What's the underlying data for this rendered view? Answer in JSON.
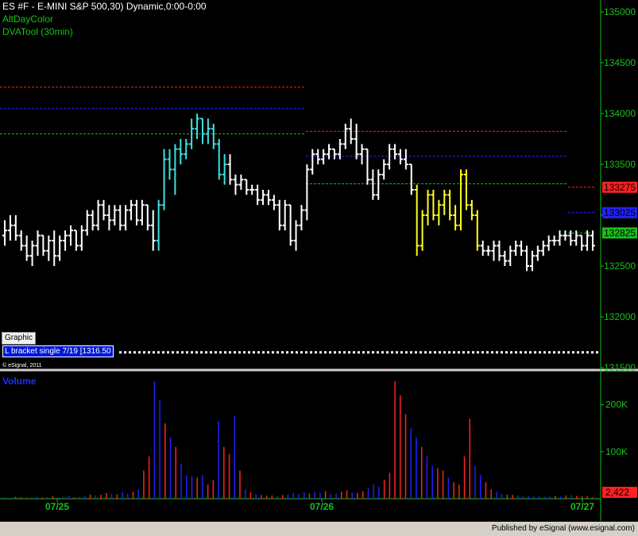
{
  "header": {
    "title": "ES #F - E-MINI S&P 500,30) Dynamic,0:00-0:00",
    "study1": "AltDayColor",
    "study2": "DVATool (30min)"
  },
  "graphic_button": "Graphic",
  "bracket_label": "L bracket single 7/19 [1316.50",
  "copyright": "© eSignal, 2011",
  "volume_title": "Volume",
  "published": "Published by eSignal (www.esignal.com)",
  "colors": {
    "background": "#000000",
    "axis_text": "#18c018",
    "up_day1": "#ffffff",
    "hi_day1": "#40e0e0",
    "hi_day2": "#ffff20",
    "vol_up": "#2020ff",
    "vol_down": "#ff2020",
    "level_red": "#ff2020",
    "level_blue": "#2020ff",
    "level_green": "#18c018"
  },
  "chart_data": [
    {
      "type": "ohlc",
      "ylim": [
        1315,
        1350
      ],
      "ytick_labels": [
        "135000",
        "134500",
        "134000",
        "133500",
        "133000",
        "132500",
        "132000",
        "131500"
      ],
      "ytick_values": [
        1350,
        1345,
        1340,
        1335,
        1330,
        1325,
        1320,
        1315
      ],
      "x_labels": [
        "07/25",
        "07/26",
        "07/27"
      ],
      "price_boxes": [
        {
          "label": "133275",
          "value": 1332.75,
          "color": "#ff2020",
          "text_color": "#000000"
        },
        {
          "label": "133025",
          "value": 1330.25,
          "color": "#2020ff",
          "text_color": "#000000"
        },
        {
          "label": "132825",
          "value": 1328.25,
          "color": "#18c018",
          "text_color": "#000000"
        }
      ],
      "levels": [
        {
          "value": 1342.6,
          "color": "#ff2020",
          "x_from": 0,
          "x_to": 385
        },
        {
          "value": 1340.5,
          "color": "#2020ff",
          "x_from": 0,
          "x_to": 385
        },
        {
          "value": 1338.0,
          "color": "#18c018",
          "x_from": 0,
          "x_to": 385
        },
        {
          "value": 1338.25,
          "color": "#ff2020",
          "x_from": 385,
          "x_to": 715
        },
        {
          "value": 1335.8,
          "color": "#2020ff",
          "x_from": 385,
          "x_to": 715
        },
        {
          "value": 1333.1,
          "color": "#18c018",
          "x_from": 385,
          "x_to": 715
        },
        {
          "value": 1332.75,
          "color": "#ff2020",
          "x_from": 715,
          "x_to": 750
        },
        {
          "value": 1330.25,
          "color": "#2020ff",
          "x_from": 715,
          "x_to": 750
        },
        {
          "value": 1328.25,
          "color": "#18c018",
          "x_from": 715,
          "x_to": 750
        },
        {
          "value": 1316.5,
          "color": "#ffffff",
          "x_from": 150,
          "x_to": 755,
          "dotted": true
        }
      ],
      "bars": [
        {
          "o": 1328.0,
          "h": 1329.5,
          "l": 1327.0,
          "c": 1328.5,
          "col": "w"
        },
        {
          "o": 1328.5,
          "h": 1330.0,
          "l": 1327.5,
          "c": 1329.0,
          "col": "w"
        },
        {
          "o": 1329.0,
          "h": 1330.0,
          "l": 1327.5,
          "c": 1328.0,
          "col": "w"
        },
        {
          "o": 1328.0,
          "h": 1328.5,
          "l": 1326.5,
          "c": 1327.0,
          "col": "w"
        },
        {
          "o": 1327.0,
          "h": 1328.0,
          "l": 1325.5,
          "c": 1326.0,
          "col": "w"
        },
        {
          "o": 1326.0,
          "h": 1327.5,
          "l": 1325.0,
          "c": 1327.0,
          "col": "w"
        },
        {
          "o": 1327.0,
          "h": 1328.5,
          "l": 1326.0,
          "c": 1328.0,
          "col": "w"
        },
        {
          "o": 1328.0,
          "h": 1328.0,
          "l": 1326.0,
          "c": 1326.5,
          "col": "w"
        },
        {
          "o": 1326.5,
          "h": 1328.0,
          "l": 1325.5,
          "c": 1327.5,
          "col": "w"
        },
        {
          "o": 1327.5,
          "h": 1328.5,
          "l": 1325.0,
          "c": 1326.0,
          "col": "w"
        },
        {
          "o": 1326.0,
          "h": 1328.0,
          "l": 1325.5,
          "c": 1327.5,
          "col": "w"
        },
        {
          "o": 1327.5,
          "h": 1328.5,
          "l": 1326.5,
          "c": 1328.0,
          "col": "w"
        },
        {
          "o": 1328.0,
          "h": 1329.0,
          "l": 1327.0,
          "c": 1328.5,
          "col": "w"
        },
        {
          "o": 1328.5,
          "h": 1328.5,
          "l": 1326.5,
          "c": 1327.0,
          "col": "w"
        },
        {
          "o": 1327.0,
          "h": 1329.0,
          "l": 1326.5,
          "c": 1328.5,
          "col": "w"
        },
        {
          "o": 1328.5,
          "h": 1330.5,
          "l": 1328.0,
          "c": 1330.0,
          "col": "w"
        },
        {
          "o": 1330.0,
          "h": 1330.5,
          "l": 1328.5,
          "c": 1329.0,
          "col": "w"
        },
        {
          "o": 1329.0,
          "h": 1331.5,
          "l": 1328.5,
          "c": 1331.0,
          "col": "w"
        },
        {
          "o": 1331.0,
          "h": 1331.5,
          "l": 1329.5,
          "c": 1330.0,
          "col": "w"
        },
        {
          "o": 1330.0,
          "h": 1331.0,
          "l": 1328.5,
          "c": 1329.5,
          "col": "w"
        },
        {
          "o": 1329.5,
          "h": 1331.0,
          "l": 1329.0,
          "c": 1330.5,
          "col": "w"
        },
        {
          "o": 1330.5,
          "h": 1331.0,
          "l": 1328.5,
          "c": 1329.0,
          "col": "w"
        },
        {
          "o": 1329.0,
          "h": 1331.0,
          "l": 1328.5,
          "c": 1330.5,
          "col": "w"
        },
        {
          "o": 1330.5,
          "h": 1331.5,
          "l": 1329.5,
          "c": 1331.0,
          "col": "w"
        },
        {
          "o": 1331.0,
          "h": 1331.5,
          "l": 1329.0,
          "c": 1329.5,
          "col": "w"
        },
        {
          "o": 1329.5,
          "h": 1331.5,
          "l": 1329.0,
          "c": 1331.0,
          "col": "w"
        },
        {
          "o": 1331.0,
          "h": 1331.0,
          "l": 1328.5,
          "c": 1329.0,
          "col": "w"
        },
        {
          "o": 1329.0,
          "h": 1330.5,
          "l": 1326.5,
          "c": 1327.5,
          "col": "w"
        },
        {
          "o": 1327.5,
          "h": 1331.5,
          "l": 1326.5,
          "c": 1331.0,
          "col": "c"
        },
        {
          "o": 1331.0,
          "h": 1336.5,
          "l": 1330.5,
          "c": 1335.5,
          "col": "c"
        },
        {
          "o": 1335.5,
          "h": 1336.5,
          "l": 1333.5,
          "c": 1334.5,
          "col": "c"
        },
        {
          "o": 1334.5,
          "h": 1337.0,
          "l": 1332.0,
          "c": 1336.5,
          "col": "c"
        },
        {
          "o": 1336.5,
          "h": 1337.5,
          "l": 1335.0,
          "c": 1336.0,
          "col": "c"
        },
        {
          "o": 1336.0,
          "h": 1337.5,
          "l": 1335.5,
          "c": 1337.0,
          "col": "c"
        },
        {
          "o": 1337.0,
          "h": 1339.5,
          "l": 1336.5,
          "c": 1338.5,
          "col": "c"
        },
        {
          "o": 1338.5,
          "h": 1340.0,
          "l": 1337.5,
          "c": 1339.5,
          "col": "c"
        },
        {
          "o": 1339.5,
          "h": 1339.5,
          "l": 1337.0,
          "c": 1338.0,
          "col": "c"
        },
        {
          "o": 1338.0,
          "h": 1339.5,
          "l": 1337.0,
          "c": 1338.5,
          "col": "c"
        },
        {
          "o": 1338.5,
          "h": 1339.0,
          "l": 1336.5,
          "c": 1337.0,
          "col": "c"
        },
        {
          "o": 1337.0,
          "h": 1337.5,
          "l": 1333.5,
          "c": 1334.0,
          "col": "c"
        },
        {
          "o": 1334.0,
          "h": 1336.0,
          "l": 1333.0,
          "c": 1335.0,
          "col": "c"
        },
        {
          "o": 1335.0,
          "h": 1336.0,
          "l": 1333.0,
          "c": 1333.5,
          "col": "w"
        },
        {
          "o": 1333.5,
          "h": 1334.0,
          "l": 1332.0,
          "c": 1333.0,
          "col": "w"
        },
        {
          "o": 1333.0,
          "h": 1334.0,
          "l": 1332.5,
          "c": 1333.5,
          "col": "w"
        },
        {
          "o": 1333.5,
          "h": 1333.5,
          "l": 1332.0,
          "c": 1332.5,
          "col": "w"
        },
        {
          "o": 1332.5,
          "h": 1333.0,
          "l": 1332.0,
          "c": 1332.5,
          "col": "w"
        },
        {
          "o": 1332.5,
          "h": 1333.0,
          "l": 1331.0,
          "c": 1331.5,
          "col": "w"
        },
        {
          "o": 1331.5,
          "h": 1332.5,
          "l": 1331.0,
          "c": 1332.0,
          "col": "w"
        },
        {
          "o": 1332.0,
          "h": 1332.5,
          "l": 1331.0,
          "c": 1331.5,
          "col": "w"
        },
        {
          "o": 1331.5,
          "h": 1332.0,
          "l": 1330.5,
          "c": 1331.0,
          "col": "w"
        },
        {
          "o": 1331.0,
          "h": 1331.5,
          "l": 1328.5,
          "c": 1329.0,
          "col": "w"
        },
        {
          "o": 1329.0,
          "h": 1331.5,
          "l": 1328.5,
          "c": 1331.0,
          "col": "w"
        },
        {
          "o": 1331.0,
          "h": 1331.0,
          "l": 1327.0,
          "c": 1327.5,
          "col": "w"
        },
        {
          "o": 1327.5,
          "h": 1329.5,
          "l": 1326.5,
          "c": 1329.0,
          "col": "w"
        },
        {
          "o": 1329.0,
          "h": 1331.0,
          "l": 1328.5,
          "c": 1330.5,
          "col": "w"
        },
        {
          "o": 1330.5,
          "h": 1335.0,
          "l": 1329.5,
          "c": 1334.5,
          "col": "w"
        },
        {
          "o": 1334.5,
          "h": 1336.5,
          "l": 1334.0,
          "c": 1336.0,
          "col": "w"
        },
        {
          "o": 1336.0,
          "h": 1336.5,
          "l": 1335.0,
          "c": 1335.5,
          "col": "w"
        },
        {
          "o": 1335.5,
          "h": 1336.5,
          "l": 1335.0,
          "c": 1336.0,
          "col": "w"
        },
        {
          "o": 1336.0,
          "h": 1337.0,
          "l": 1335.5,
          "c": 1336.5,
          "col": "w"
        },
        {
          "o": 1336.5,
          "h": 1336.5,
          "l": 1335.5,
          "c": 1336.0,
          "col": "w"
        },
        {
          "o": 1336.0,
          "h": 1337.5,
          "l": 1335.5,
          "c": 1337.0,
          "col": "w"
        },
        {
          "o": 1337.0,
          "h": 1339.0,
          "l": 1336.5,
          "c": 1338.5,
          "col": "w"
        },
        {
          "o": 1338.5,
          "h": 1339.5,
          "l": 1337.0,
          "c": 1337.5,
          "col": "w"
        },
        {
          "o": 1337.5,
          "h": 1339.0,
          "l": 1335.5,
          "c": 1336.0,
          "col": "w"
        },
        {
          "o": 1336.0,
          "h": 1337.0,
          "l": 1335.0,
          "c": 1336.5,
          "col": "w"
        },
        {
          "o": 1336.5,
          "h": 1336.5,
          "l": 1333.0,
          "c": 1333.5,
          "col": "w"
        },
        {
          "o": 1333.5,
          "h": 1334.5,
          "l": 1331.5,
          "c": 1332.0,
          "col": "w"
        },
        {
          "o": 1332.0,
          "h": 1334.5,
          "l": 1331.5,
          "c": 1334.0,
          "col": "w"
        },
        {
          "o": 1334.0,
          "h": 1335.5,
          "l": 1333.5,
          "c": 1335.0,
          "col": "w"
        },
        {
          "o": 1335.0,
          "h": 1337.0,
          "l": 1334.5,
          "c": 1336.5,
          "col": "w"
        },
        {
          "o": 1336.5,
          "h": 1337.0,
          "l": 1335.5,
          "c": 1336.0,
          "col": "w"
        },
        {
          "o": 1336.0,
          "h": 1336.5,
          "l": 1335.0,
          "c": 1335.5,
          "col": "w"
        },
        {
          "o": 1335.5,
          "h": 1336.5,
          "l": 1334.5,
          "c": 1335.0,
          "col": "w"
        },
        {
          "o": 1335.0,
          "h": 1335.0,
          "l": 1332.0,
          "c": 1332.5,
          "col": "w"
        },
        {
          "o": 1332.5,
          "h": 1333.0,
          "l": 1326.0,
          "c": 1327.0,
          "col": "y"
        },
        {
          "o": 1327.0,
          "h": 1330.5,
          "l": 1326.5,
          "c": 1330.0,
          "col": "y"
        },
        {
          "o": 1330.0,
          "h": 1332.5,
          "l": 1329.0,
          "c": 1332.0,
          "col": "y"
        },
        {
          "o": 1332.0,
          "h": 1332.5,
          "l": 1329.5,
          "c": 1330.0,
          "col": "y"
        },
        {
          "o": 1330.0,
          "h": 1331.5,
          "l": 1329.0,
          "c": 1331.0,
          "col": "y"
        },
        {
          "o": 1331.0,
          "h": 1332.5,
          "l": 1330.0,
          "c": 1332.0,
          "col": "y"
        },
        {
          "o": 1332.0,
          "h": 1332.5,
          "l": 1329.5,
          "c": 1330.0,
          "col": "y"
        },
        {
          "o": 1330.0,
          "h": 1331.0,
          "l": 1328.5,
          "c": 1329.0,
          "col": "y"
        },
        {
          "o": 1329.0,
          "h": 1334.5,
          "l": 1328.5,
          "c": 1334.0,
          "col": "y"
        },
        {
          "o": 1334.0,
          "h": 1334.5,
          "l": 1330.5,
          "c": 1331.0,
          "col": "y"
        },
        {
          "o": 1331.0,
          "h": 1331.5,
          "l": 1329.5,
          "c": 1330.0,
          "col": "y"
        },
        {
          "o": 1330.0,
          "h": 1330.5,
          "l": 1326.5,
          "c": 1327.0,
          "col": "y"
        },
        {
          "o": 1327.0,
          "h": 1327.5,
          "l": 1326.0,
          "c": 1326.5,
          "col": "w"
        },
        {
          "o": 1326.5,
          "h": 1327.0,
          "l": 1326.0,
          "c": 1326.5,
          "col": "w"
        },
        {
          "o": 1326.5,
          "h": 1327.5,
          "l": 1325.5,
          "c": 1327.0,
          "col": "w"
        },
        {
          "o": 1327.0,
          "h": 1327.5,
          "l": 1325.5,
          "c": 1326.0,
          "col": "w"
        },
        {
          "o": 1326.0,
          "h": 1326.5,
          "l": 1325.0,
          "c": 1325.5,
          "col": "w"
        },
        {
          "o": 1325.5,
          "h": 1327.0,
          "l": 1325.0,
          "c": 1326.5,
          "col": "w"
        },
        {
          "o": 1326.5,
          "h": 1327.5,
          "l": 1326.0,
          "c": 1327.0,
          "col": "w"
        },
        {
          "o": 1327.0,
          "h": 1327.5,
          "l": 1326.0,
          "c": 1326.5,
          "col": "w"
        },
        {
          "o": 1326.5,
          "h": 1327.0,
          "l": 1324.5,
          "c": 1325.0,
          "col": "w"
        },
        {
          "o": 1325.0,
          "h": 1326.5,
          "l": 1324.5,
          "c": 1326.0,
          "col": "w"
        },
        {
          "o": 1326.0,
          "h": 1327.0,
          "l": 1325.5,
          "c": 1326.5,
          "col": "w"
        },
        {
          "o": 1326.5,
          "h": 1327.5,
          "l": 1326.0,
          "c": 1327.0,
          "col": "w"
        },
        {
          "o": 1327.0,
          "h": 1328.0,
          "l": 1326.5,
          "c": 1327.5,
          "col": "w"
        },
        {
          "o": 1327.5,
          "h": 1328.0,
          "l": 1327.0,
          "c": 1327.5,
          "col": "w"
        },
        {
          "o": 1327.5,
          "h": 1328.5,
          "l": 1327.0,
          "c": 1328.0,
          "col": "w"
        },
        {
          "o": 1328.0,
          "h": 1328.5,
          "l": 1327.5,
          "c": 1328.0,
          "col": "w"
        },
        {
          "o": 1328.0,
          "h": 1328.5,
          "l": 1327.0,
          "c": 1327.5,
          "col": "w"
        },
        {
          "o": 1327.5,
          "h": 1328.5,
          "l": 1327.0,
          "c": 1328.0,
          "col": "w"
        },
        {
          "o": 1328.0,
          "h": 1328.0,
          "l": 1326.5,
          "c": 1327.0,
          "col": "w"
        },
        {
          "o": 1327.0,
          "h": 1328.5,
          "l": 1326.5,
          "c": 1328.0,
          "col": "w"
        },
        {
          "o": 1328.0,
          "h": 1328.5,
          "l": 1326.5,
          "c": 1327.0,
          "col": "w"
        }
      ]
    },
    {
      "type": "bar",
      "title": "Volume",
      "ylim": [
        0,
        250000
      ],
      "ytick_labels": [
        "200K",
        "100K"
      ],
      "ytick_values": [
        200000,
        100000
      ],
      "last_value_label": "2,422",
      "values": [
        3000,
        2000,
        4000,
        3000,
        2000,
        3000,
        4000,
        2000,
        3000,
        5000,
        3000,
        4000,
        6000,
        3000,
        4000,
        5000,
        9000,
        7000,
        8000,
        12000,
        10000,
        9000,
        14000,
        11000,
        15000,
        20000,
        60000,
        90000,
        250000,
        210000,
        160000,
        130000,
        110000,
        75000,
        50000,
        48000,
        45000,
        50000,
        30000,
        40000,
        165000,
        110000,
        95000,
        175000,
        60000,
        20000,
        14000,
        10000,
        8000,
        6000,
        7000,
        5000,
        8000,
        9000,
        12000,
        10000,
        13000,
        11000,
        14000,
        12000,
        16000,
        9000,
        11000,
        15000,
        18000,
        13000,
        12000,
        16000,
        22000,
        30000,
        25000,
        40000,
        55000,
        250000,
        220000,
        180000,
        150000,
        130000,
        110000,
        90000,
        70000,
        65000,
        60000,
        45000,
        35000,
        30000,
        90000,
        170000,
        70000,
        50000,
        35000,
        20000,
        15000,
        10000,
        9000,
        8000,
        7000,
        6000,
        6000,
        5000,
        5000,
        4000,
        5000,
        6000,
        5000,
        7000,
        8000,
        6000,
        5000,
        5000,
        2422
      ]
    }
  ]
}
